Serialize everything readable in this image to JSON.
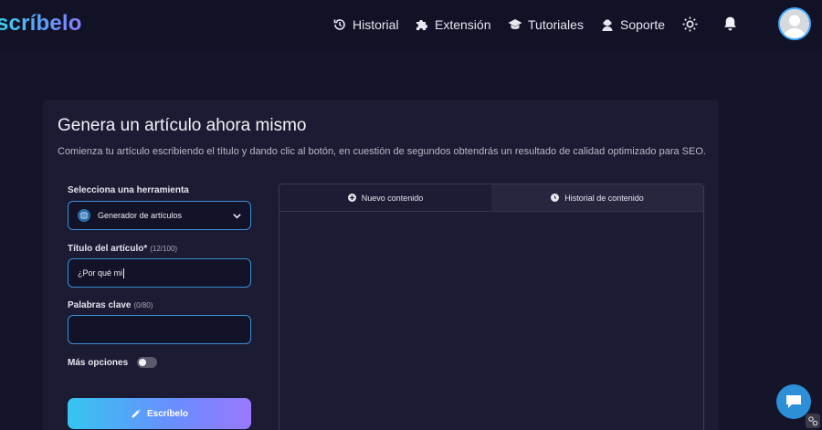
{
  "header": {
    "logo": "scríbelo",
    "nav": [
      {
        "label": "Historial",
        "icon": "history-icon"
      },
      {
        "label": "Extensión",
        "icon": "puzzle-icon"
      },
      {
        "label": "Tutoriales",
        "icon": "graduation-cap-icon"
      },
      {
        "label": "Soporte",
        "icon": "support-agent-icon"
      }
    ]
  },
  "card": {
    "title": "Genera un artículo ahora mismo",
    "description": "Comienza tu artículo escribiendo el título y dando clic al botón, en cuestión de segundos obtendrás un resultado de calidad optimizado para SEO."
  },
  "form": {
    "tool_label": "Selecciona una herramienta",
    "tool_value": "Generador de artículos",
    "title_label": "Título del artículo*",
    "title_count": "(12/100)",
    "title_value": "¿Por qué mi",
    "keywords_label": "Palabras clave",
    "keywords_count": "(0/80)",
    "keywords_value": "",
    "more_options_label": "Más opciones",
    "more_options_enabled": false,
    "submit_label": "Escríbelo"
  },
  "panel": {
    "tabs": [
      {
        "label": "Nuevo contenido",
        "active": false
      },
      {
        "label": "Historial de contenido",
        "active": true
      }
    ]
  },
  "colors": {
    "accent_blue": "#3c8fd6",
    "gradient_start": "#35c5f0",
    "gradient_end": "#9a78ff",
    "background": "#14142a"
  }
}
